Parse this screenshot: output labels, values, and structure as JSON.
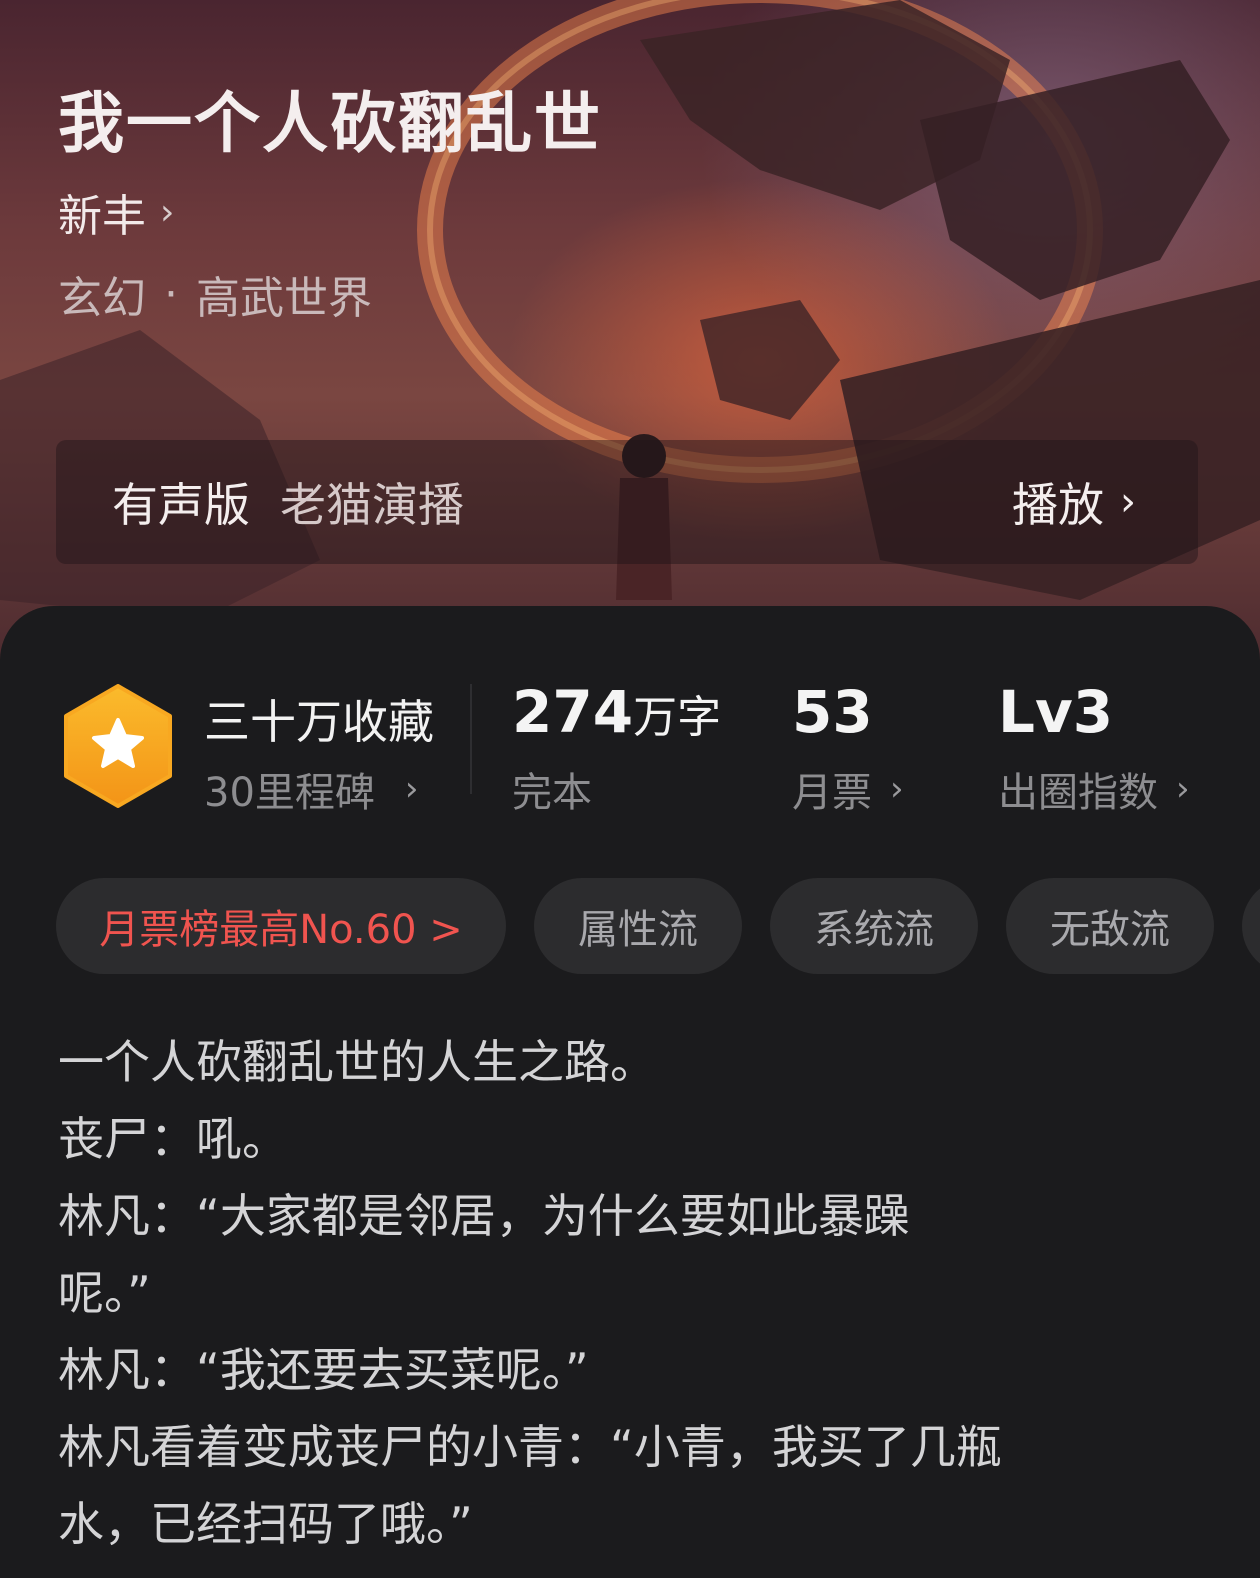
{
  "book": {
    "title": "我一个人砍翻乱世",
    "author": "新丰",
    "category": "玄幻",
    "subcategory": "高武世界",
    "separator": "·"
  },
  "audio": {
    "label": "有声版",
    "narrator": "老猫演播",
    "play_label": "播放"
  },
  "stats": {
    "milestone_title": "三十万收藏",
    "milestone_sub": "30里程碑",
    "word_count": "274",
    "word_unit": "万字",
    "status": "完本",
    "monthly_tickets": "53",
    "monthly_tickets_label": "月票",
    "level": "Lv3",
    "level_label": "出圈指数"
  },
  "tags": [
    "月票榜最高No.60 >",
    "属性流",
    "系统流",
    "无敌流"
  ],
  "description": [
    "一个人砍翻乱世的人生之路。",
    "丧尸：吼。",
    "林凡：“大家都是邻居，为什么要如此暴躁",
    "呢。”",
    "林凡：“我还要去买菜呢。”",
    "林凡看着变成丧尸的小青：“小青，我买了几瓶",
    "水，已经扫码了哦。”"
  ],
  "icons": {
    "chevron": "chevron-right-icon",
    "badge": "star-hexagon-badge-icon"
  },
  "colors": {
    "rank_tag": "#f0544f",
    "badge_gold": "#f7a21b",
    "sheet_bg": "#1b1b1d"
  }
}
